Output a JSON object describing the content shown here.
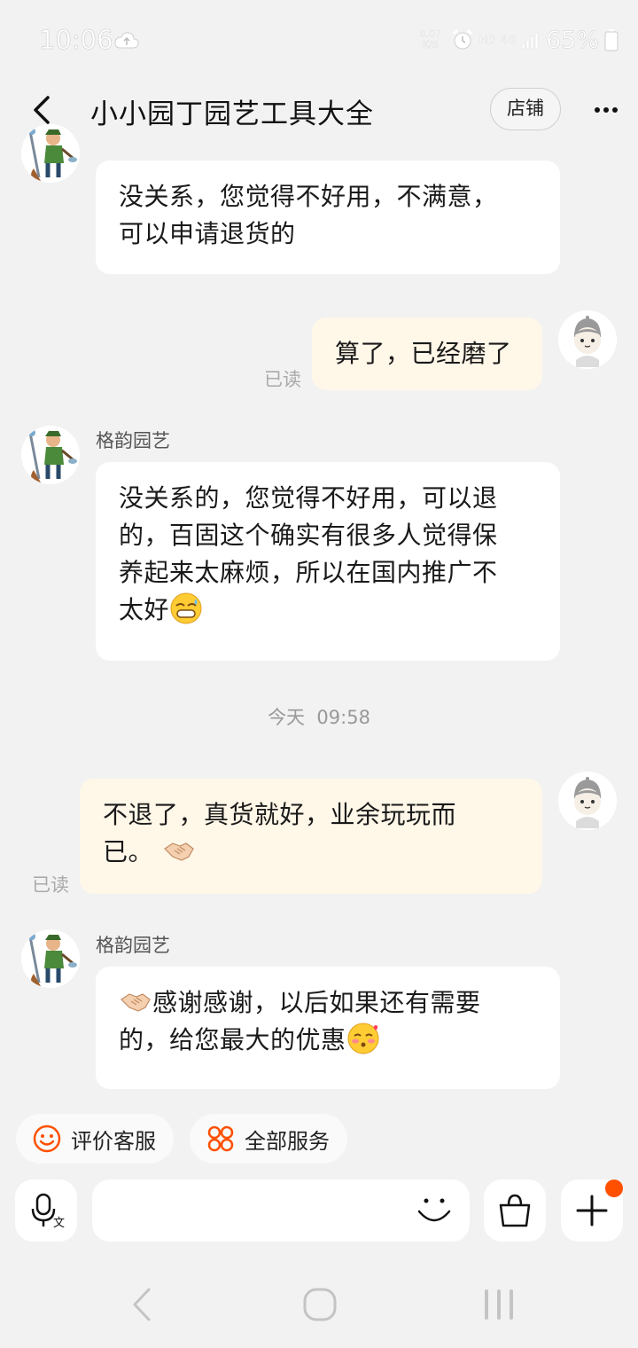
{
  "status_bar": {
    "time": "10:06",
    "net_speed_value": "0.07",
    "net_speed_unit": "K/S",
    "hd_label": "HD",
    "network_label": "4G",
    "battery": "65%"
  },
  "header": {
    "title": "小小园丁园艺工具大全",
    "shop_button": "店铺"
  },
  "messages": [
    {
      "side": "left",
      "sender": "",
      "lines": [
        "没关系，您觉得不好用，不满意，",
        "可以申请退货的"
      ]
    },
    {
      "side": "right",
      "read": "已读",
      "lines": [
        "算了，已经磨了"
      ]
    },
    {
      "side": "left",
      "sender": "格韵园艺",
      "lines": [
        "没关系的，您觉得不好用，可以退",
        "的，百固这个确实有很多人觉得保",
        "养起来太麻烦，所以在国内推广不",
        "太好"
      ],
      "emoji": "sweat-smile-emoji"
    },
    {
      "side": "right",
      "read": "已读",
      "lines": [
        "不退了，真货就好，业余玩玩而",
        "已。"
      ],
      "emoji": "handshake-emoji"
    },
    {
      "side": "left",
      "sender": "格韵园艺",
      "lines": [
        "感谢感谢，以后如果还有需要",
        "的，给您最大的优惠"
      ],
      "emoji_start": "handshake-emoji",
      "emoji": "blushing-kiss-emoji"
    }
  ],
  "timestamp": "今天  09:58",
  "quick_actions": [
    {
      "label": "评价客服",
      "icon": "smiley-icon"
    },
    {
      "label": "全部服务",
      "icon": "services-icon"
    }
  ],
  "input_bar": {
    "value": "",
    "icons": [
      "voice-translate-icon",
      "emoji-smile-icon",
      "shopping-bag-icon",
      "plus-icon"
    ]
  },
  "colors": {
    "accent": "#ff5000",
    "seller_bubble": "#ffffff",
    "buyer_bubble": "#fff7e8",
    "background": "#f2f2f2"
  }
}
